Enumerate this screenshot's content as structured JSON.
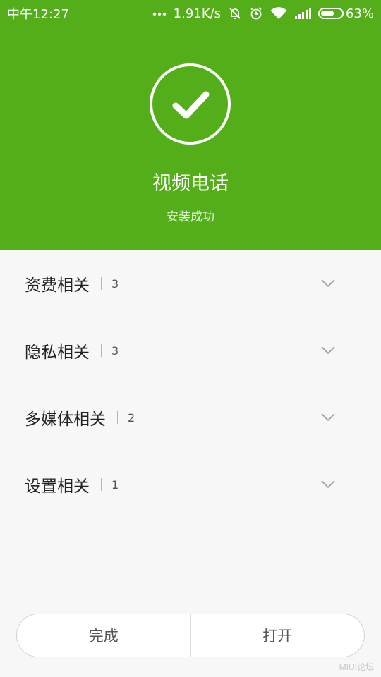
{
  "status_bar": {
    "time": "中午12:27",
    "network_speed": "1.91K/s",
    "battery_percent": "63%",
    "battery_level": 0.63,
    "icons": [
      "more-dots-icon",
      "mute-bell-icon",
      "alarm-icon",
      "wifi-icon",
      "signal-icon",
      "battery-icon"
    ]
  },
  "header": {
    "background_color": "#53ae1a",
    "icon": "check-circle-icon",
    "app_name": "视频电话",
    "install_status": "安装成功"
  },
  "permissions": [
    {
      "label": "资费相关",
      "count": "3"
    },
    {
      "label": "隐私相关",
      "count": "3"
    },
    {
      "label": "多媒体相关",
      "count": "2"
    },
    {
      "label": "设置相关",
      "count": "1"
    }
  ],
  "actions": {
    "done_label": "完成",
    "open_label": "打开"
  },
  "watermark": "MIUI论坛"
}
